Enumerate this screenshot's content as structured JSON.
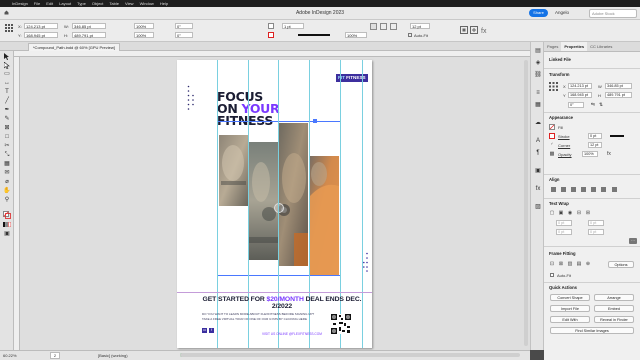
{
  "menubar": {
    "items": [
      "InDesign",
      "File",
      "Edit",
      "Layout",
      "Type",
      "Object",
      "Table",
      "View",
      "Window",
      "Help"
    ]
  },
  "titlebar": {
    "title": "Adobe InDesign 2023",
    "share": "Share",
    "user": "Angelo",
    "stock_placeholder": "Adobe Stock"
  },
  "control": {
    "x": "124.213 pt",
    "y": "168.945 pt",
    "w": "346.85 pt",
    "h": "489.791 pt",
    "scale_x": "100%",
    "scale_y": "100%",
    "rotate": "0°",
    "shear": "0°",
    "stroke_weight": "1 pt",
    "zoom": "100%",
    "gap": "12 pt",
    "autofit": "Auto-Fit"
  },
  "doc_tab": "*Compound_Path.indd @ 60% [GPU Preview]",
  "poster": {
    "headline_1": "FOCUS",
    "headline_2a": "ON ",
    "headline_2b": "YOUR",
    "headline_3": "FITNESS",
    "badge_a": "FIT",
    "badge_b": "FITNESS",
    "cta_a": "GET STARTED FOR ",
    "cta_b": "$20/MONTH",
    "cta_c": " DEAL ENDS DEC. 2/2022",
    "copy_1": "DO YOU WANT TO LEARN MORE ABOUT FLEXFITNESS BEFORE SIGNING UP?",
    "copy_2": "TAKE A FREE VIRTUAL TOUR OF ONE OF OUR GYMS BY CLICKING HERE",
    "url": "VISIT US ONLINE @FLEXFITNESS.COM",
    "accent_color": "#7a38ff",
    "dark_color": "#1b1d33"
  },
  "status": {
    "zoom": "60.22%",
    "page": "2",
    "style": "[Basic] (working)",
    "errors": "No errors"
  },
  "panel": {
    "tabs": [
      "Pages",
      "Properties",
      "CC Libraries"
    ],
    "linked_file": "Linked File",
    "transform": "Transform",
    "x": "124.213 pt",
    "y": "168.945 pt",
    "w": "346.85 pt",
    "h": "489.791 pt",
    "rotate": "0°",
    "appearance": "Appearance",
    "fill": "Fill",
    "stroke": "Stroke",
    "stroke_val": "0 pt",
    "corner": "Corner",
    "corner_val": "12 pt",
    "opacity": "Opacity",
    "opacity_val": "100%",
    "align": "Align",
    "text_wrap": "Text Wrap",
    "wrap_val": "0 pt",
    "frame_fitting": "Frame Fitting",
    "autofit": "Auto-Fit",
    "options": "Options",
    "quick_actions": "Quick Actions",
    "btn_convert": "Convert Shape",
    "btn_arrange": "Arrange",
    "btn_import": "Import File",
    "btn_embed": "Embed",
    "btn_edit": "Edit With",
    "btn_reveal": "Reveal in Finder",
    "btn_similar": "Find Similar Images"
  }
}
